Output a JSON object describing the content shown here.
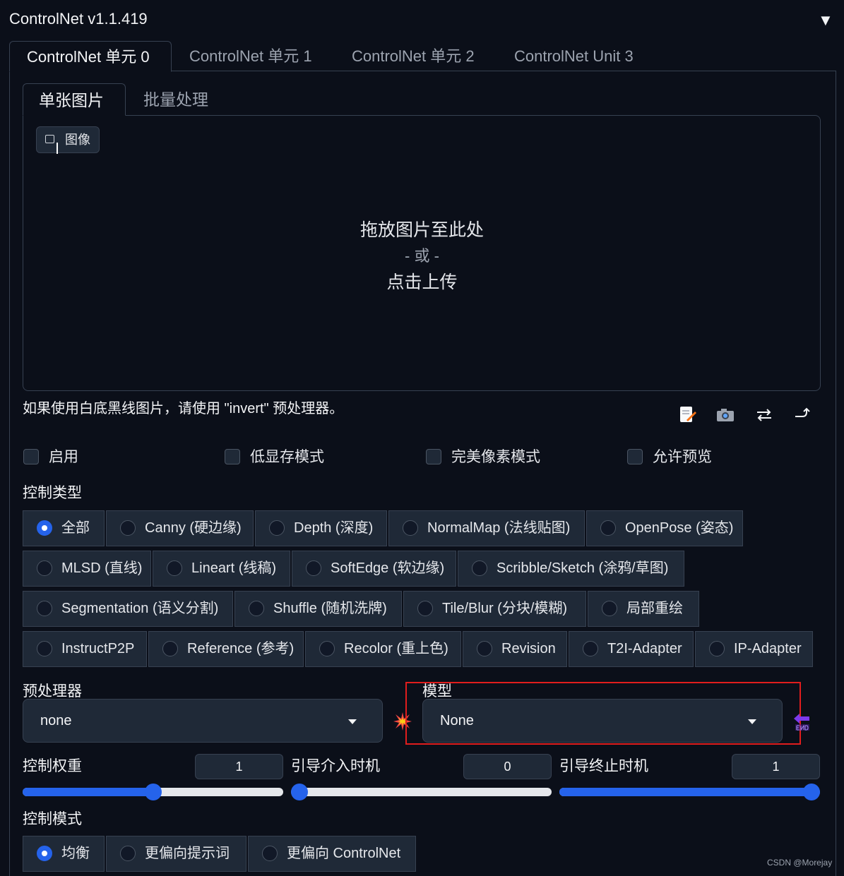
{
  "header": {
    "title": "ControlNet v1.1.419",
    "collapse_glyph": "▼"
  },
  "unit_tabs": [
    "ControlNet 单元 0",
    "ControlNet 单元 1",
    "ControlNet 单元 2",
    "ControlNet Unit 3"
  ],
  "sub_tabs": [
    "单张图片",
    "批量处理"
  ],
  "upload": {
    "label": "图像",
    "line1": "拖放图片至此处",
    "or": "- 或 -",
    "line2": "点击上传"
  },
  "hint": "如果使用白底黑线图片，请使用 \"invert\" 预处理器。",
  "tool_icons": [
    "edit-icon",
    "camera-icon",
    "swap-icon",
    "send-dimensions-icon"
  ],
  "checkboxes": [
    "启用",
    "低显存模式",
    "完美像素模式",
    "允许预览"
  ],
  "control_type": {
    "label": "控制类型",
    "selected": "全部",
    "options": [
      "全部",
      "Canny (硬边缘)",
      "Depth (深度)",
      "NormalMap (法线贴图)",
      "OpenPose (姿态)",
      "MLSD (直线)",
      "Lineart (线稿)",
      "SoftEdge (软边缘)",
      "Scribble/Sketch (涂鸦/草图)",
      "Segmentation (语义分割)",
      "Shuffle (随机洗牌)",
      "Tile/Blur (分块/模糊)",
      "局部重绘",
      "InstructP2P",
      "Reference (参考)",
      "Recolor (重上色)",
      "Revision",
      "T2I-Adapter",
      "IP-Adapter"
    ]
  },
  "preprocessor": {
    "label": "预处理器",
    "value": "none"
  },
  "model": {
    "label": "模型",
    "value": "None"
  },
  "weight": {
    "label": "控制权重",
    "value": "1",
    "fraction": 0.5
  },
  "start": {
    "label": "引导介入时机",
    "value": "0",
    "fraction": 0.0
  },
  "end": {
    "label": "引导终止时机",
    "value": "1",
    "fraction": 1.0
  },
  "control_mode": {
    "label": "控制模式",
    "selected": "均衡",
    "options": [
      "均衡",
      "更偏向提示词",
      "更偏向 ControlNet"
    ]
  },
  "watermark": "CSDN @Morejay",
  "colors": {
    "background": "#0b0f19",
    "accent": "#2563eb",
    "highlight_box": "#e11d1d"
  }
}
